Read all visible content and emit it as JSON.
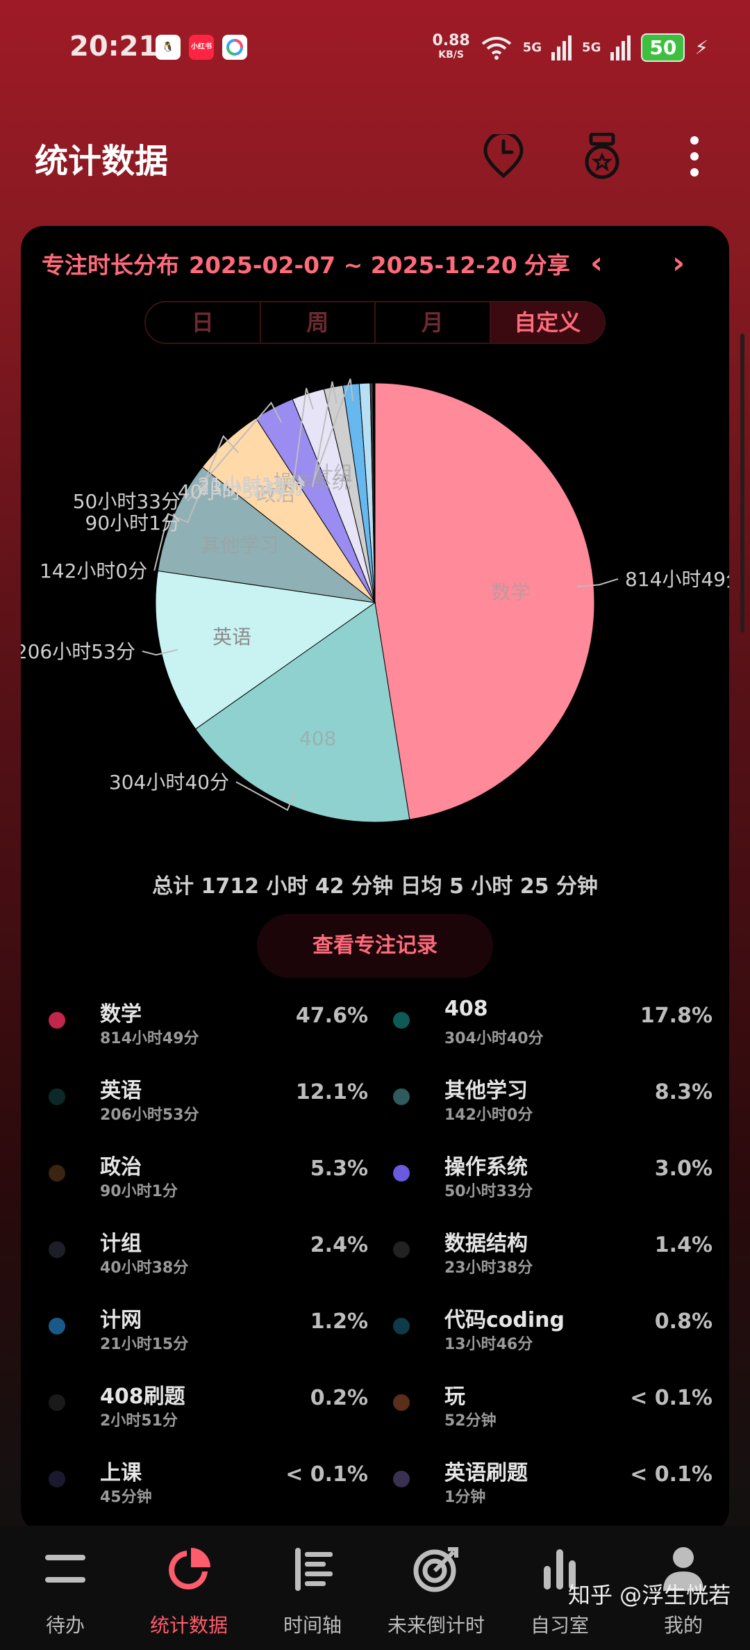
{
  "status_bar": {
    "time": "20:21",
    "apps": [
      "qq-icon",
      "xiaohongshu-icon",
      "browser-icon"
    ],
    "xiaohongshu_label": "小红书",
    "net_speed": "0.88",
    "net_unit": "KB/S",
    "sig1": "5G",
    "sig2": "5G",
    "battery": "50"
  },
  "app_bar": {
    "title": "统计数据",
    "icons": [
      "clock-pin-icon",
      "medal-icon",
      "more-vert-icon"
    ]
  },
  "card": {
    "header_label": "专注时长分布",
    "date_range": "2025-02-07 ~ 2025-12-20",
    "share": "分享",
    "segments": [
      "日",
      "周",
      "月",
      "自定义"
    ],
    "active_segment": "自定义",
    "summary": "总计 1712 小时 42 分钟 日均 5 小时 25 分钟",
    "records_button": "查看专注记录"
  },
  "chart_data": {
    "type": "pie",
    "slices": [
      {
        "name": "数学",
        "duration": "814小时49分",
        "percent": 47.6,
        "color": "#ff8a9a"
      },
      {
        "name": "408",
        "duration": "304小时40分",
        "percent": 17.8,
        "color": "#8fd1cf"
      },
      {
        "name": "英语",
        "duration": "206小时53分",
        "percent": 12.1,
        "color": "#c9f3f3"
      },
      {
        "name": "其他学习",
        "duration": "142小时0分",
        "percent": 8.3,
        "color": "#8fb0b4"
      },
      {
        "name": "政治",
        "duration": "90小时1分",
        "percent": 5.3,
        "color": "#ffd9a8"
      },
      {
        "name": "操作系统",
        "duration": "50小时33分",
        "percent": 3.0,
        "color": "#9a8cf0"
      },
      {
        "name": "计组",
        "duration": "40小时38分",
        "percent": 2.4,
        "color": "#e8e4f8"
      },
      {
        "name": "数据结构",
        "duration": "23小时38分",
        "percent": 1.4,
        "color": "#cfcfcf"
      },
      {
        "name": "计网",
        "duration": "21小时15分",
        "percent": 1.2,
        "color": "#66b8ee"
      },
      {
        "name": "代码coding",
        "duration": "13小时46分",
        "percent": 0.8,
        "color": "#b8e0f5"
      },
      {
        "name": "408刷题",
        "duration": "2小时51分",
        "percent": 0.2,
        "color": "#3a3a3a"
      },
      {
        "name": "玩",
        "duration": "52分钟",
        "percent": "< 0.1",
        "color": "#a0522d"
      },
      {
        "name": "上课",
        "duration": "45分钟",
        "percent": "< 0.1",
        "color": "#2a2a4a"
      },
      {
        "name": "英语刷题",
        "duration": "1分钟",
        "percent": "< 0.1",
        "color": "#4a3f6b"
      }
    ],
    "outside_labels": {
      "数学": "814小时49分",
      "408": "304小时40分",
      "英语": "206小时53分",
      "其他学习": "142小时0分",
      "政治": "90小时1分",
      "操作系统": "50小时33分",
      "计组": "40小时38分",
      "数据结构": "23小时38分",
      "计网": "21小时15分"
    }
  },
  "legend": [
    {
      "name": "数学",
      "duration": "814小时49分",
      "pct": "47.6%",
      "dot": "#c2264a"
    },
    {
      "name": "408",
      "duration": "304小时40分",
      "pct": "17.8%",
      "dot": "#0e5a57"
    },
    {
      "name": "英语",
      "duration": "206小时53分",
      "pct": "12.1%",
      "dot": "#0a2a2a"
    },
    {
      "name": "其他学习",
      "duration": "142小时0分",
      "pct": "8.3%",
      "dot": "#2f5a5e"
    },
    {
      "name": "政治",
      "duration": "90小时1分",
      "pct": "5.3%",
      "dot": "#3a2510"
    },
    {
      "name": "操作系统",
      "duration": "50小时33分",
      "pct": "3.0%",
      "dot": "#6a5ae0"
    },
    {
      "name": "计组",
      "duration": "40小时38分",
      "pct": "2.4%",
      "dot": "#1e1e28"
    },
    {
      "name": "数据结构",
      "duration": "23小时38分",
      "pct": "1.4%",
      "dot": "#222222"
    },
    {
      "name": "计网",
      "duration": "21小时15分",
      "pct": "1.2%",
      "dot": "#1a5a8a"
    },
    {
      "name": "代码coding",
      "duration": "13小时46分",
      "pct": "0.8%",
      "dot": "#0e3a4a"
    },
    {
      "name": "408刷题",
      "duration": "2小时51分",
      "pct": "0.2%",
      "dot": "#1a1a1a"
    },
    {
      "name": "玩",
      "duration": "52分钟",
      "pct": "< 0.1%",
      "dot": "#5a2e1a"
    },
    {
      "name": "上课",
      "duration": "45分钟",
      "pct": "< 0.1%",
      "dot": "#1a1a2e"
    },
    {
      "name": "英语刷题",
      "duration": "1分钟",
      "pct": "< 0.1%",
      "dot": "#3a3052"
    }
  ],
  "bottom_nav": {
    "items": [
      {
        "label": "待办",
        "icon": "todo-list-icon"
      },
      {
        "label": "统计数据",
        "icon": "pie-chart-icon"
      },
      {
        "label": "时间轴",
        "icon": "timeline-icon"
      },
      {
        "label": "未来倒计时",
        "icon": "target-icon"
      },
      {
        "label": "自习室",
        "icon": "bar-chart-icon"
      },
      {
        "label": "我的",
        "icon": "person-icon"
      }
    ],
    "active": "统计数据"
  },
  "watermark": "知乎 @浮生恍若",
  "colors": {
    "accent": "#ff6b7a",
    "background_top": "#9e1a26",
    "card": "#000000"
  }
}
